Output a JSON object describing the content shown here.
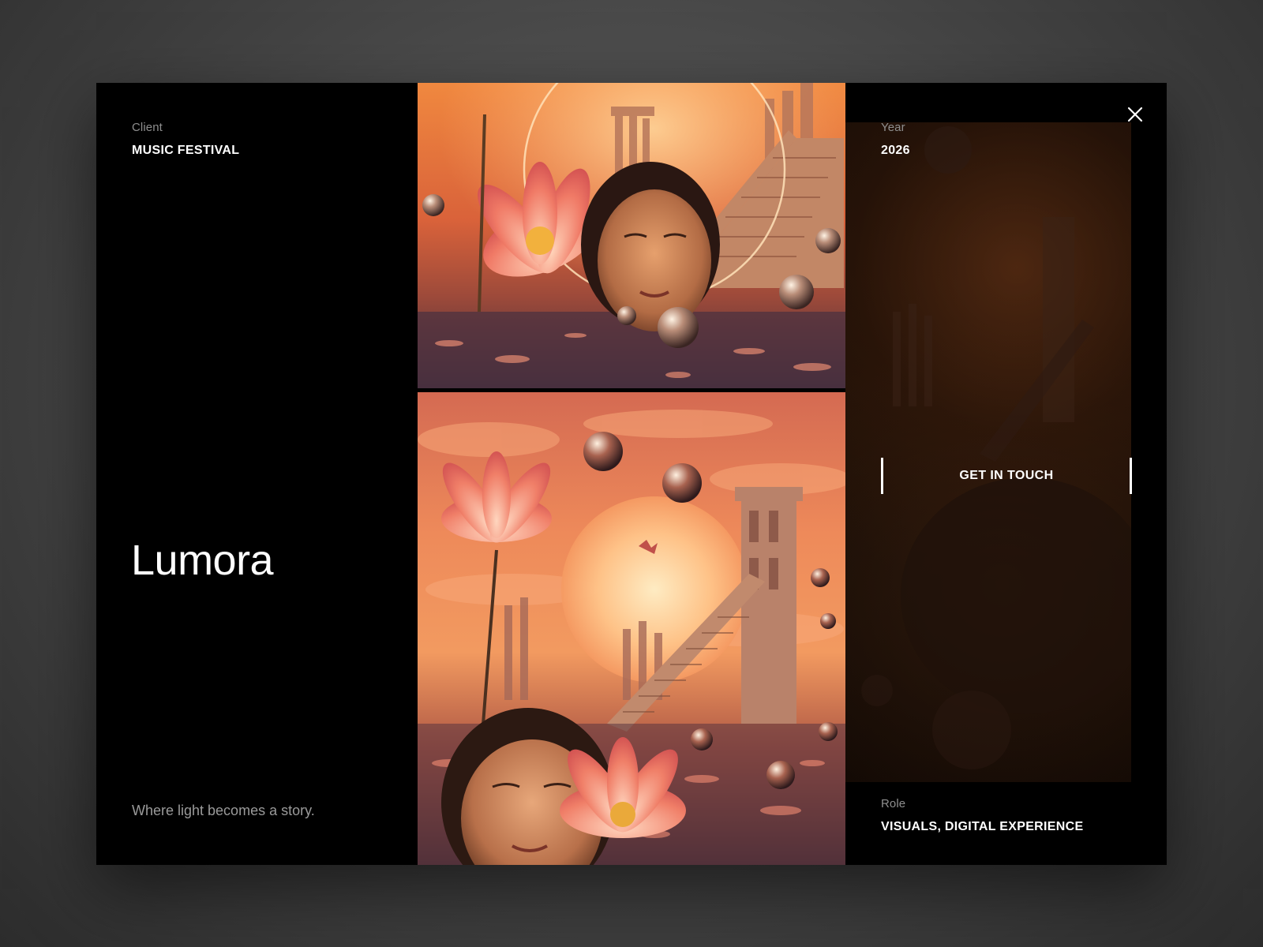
{
  "client": {
    "label": "Client",
    "value": "MUSIC FESTIVAL"
  },
  "project": {
    "title": "Lumora",
    "tagline": "Where light becomes a story."
  },
  "year": {
    "label": "Year",
    "value": "2026"
  },
  "role": {
    "label": "Role",
    "value": "VISUALS, DIGITAL EXPERIENCE"
  },
  "cta": {
    "label": "GET IN TOUCH"
  },
  "close": {
    "icon": "close-icon"
  },
  "colors": {
    "background": "#000000",
    "label": "#8f8f8f",
    "value": "#ffffff",
    "accent_warm": "#e8774a"
  }
}
